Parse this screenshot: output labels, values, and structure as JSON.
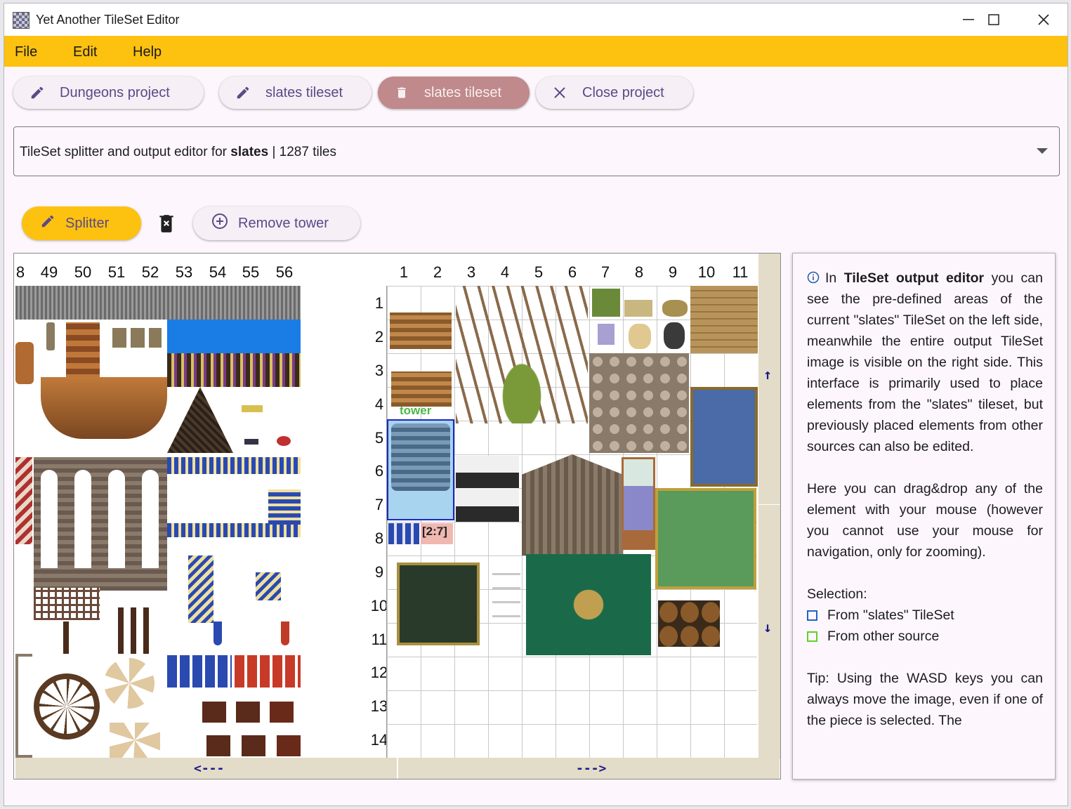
{
  "window": {
    "title": "Yet Another TileSet Editor",
    "minimize": "—",
    "maximize": "☐",
    "close": "✕"
  },
  "menu": {
    "items": [
      "File",
      "Edit",
      "Help"
    ]
  },
  "project_tabs": [
    {
      "label": "Dungeons project",
      "icon": "pencil-icon",
      "selected": false
    },
    {
      "label": "slates tileset",
      "icon": "pencil-icon",
      "selected": false
    },
    {
      "label": "slates tileset",
      "icon": "trash-icon",
      "selected": true
    },
    {
      "label": "Close project",
      "icon": "close-icon",
      "selected": false
    }
  ],
  "selector": {
    "prefix": "TileSet splitter and output editor for ",
    "name": "slates",
    "suffix": " | 1287 tiles"
  },
  "toolbar": {
    "splitter_label": "Splitter",
    "remove_label": "Remove tower"
  },
  "left_columns": [
    "8",
    "49",
    "50",
    "51",
    "52",
    "53",
    "54",
    "55",
    "56"
  ],
  "right_columns": [
    "1",
    "2",
    "3",
    "4",
    "5",
    "6",
    "7",
    "8",
    "9",
    "10",
    "11"
  ],
  "rows": [
    "1",
    "2",
    "3",
    "4",
    "5",
    "6",
    "7",
    "8",
    "9",
    "10",
    "11",
    "12",
    "13",
    "14"
  ],
  "canvas": {
    "tower_label": "tower",
    "coord_label": "[2:7]",
    "scroll_up": "↑",
    "scroll_down": "↓",
    "scroll_left": "<---",
    "scroll_right": "--->"
  },
  "info": {
    "p1_icon": "info-icon",
    "p1_a": "In ",
    "p1_b": "TileSet output editor",
    "p1_c": " you can see the pre-defined areas of the current \"slates\" TileSet on the left side, meanwhile the entire output TileSet image is visible on the right side. This interface is primarily used to place elements from the \"slates\" tileset, but previously placed elements from other sources can also be edited.",
    "p2": "Here you can drag&drop any of the element with your mouse (however you cannot use your mouse for navigation, only for zooming).",
    "selection_title": "Selection:",
    "legend_slates": "From \"slates\" TileSet",
    "legend_other": "From other source",
    "tip": "Tip: Using the WASD keys you can always move the image, even if one of the piece is selected. The"
  },
  "colors": {
    "accent": "#fdc110",
    "selected_tab": "#c0898b",
    "slates_selection": "#1f63c7",
    "other_selection": "#5ed12c"
  }
}
